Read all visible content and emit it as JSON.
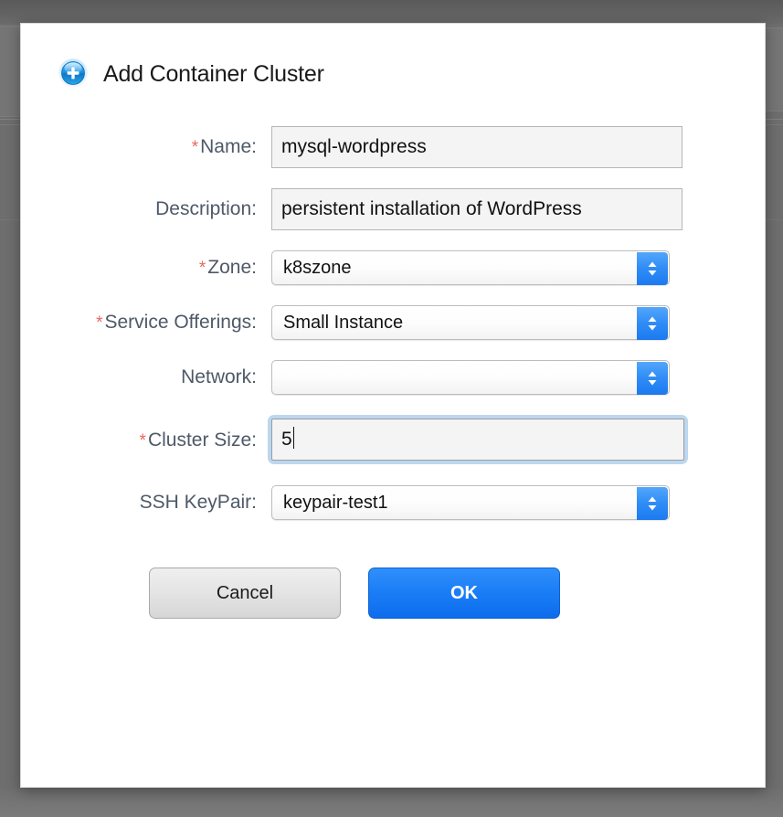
{
  "backdrop": {
    "color": "#6e6e6e"
  },
  "dialog": {
    "title": "Add Container Cluster",
    "title_icon": "add-plus-circle-icon",
    "accent_color": "#1a7df5",
    "required_marker": "*"
  },
  "form": {
    "fields": [
      {
        "key": "name",
        "label": "Name:",
        "required": true,
        "type": "text",
        "value": "mysql-wordpress",
        "placeholder": ""
      },
      {
        "key": "description",
        "label": "Description:",
        "required": false,
        "type": "text",
        "value": "persistent installation of WordPress",
        "placeholder": ""
      },
      {
        "key": "zone",
        "label": "Zone:",
        "required": true,
        "type": "select",
        "value": "k8szone"
      },
      {
        "key": "service_offerings",
        "label": "Service Offerings:",
        "required": true,
        "type": "select",
        "value": "Small Instance"
      },
      {
        "key": "network",
        "label": "Network:",
        "required": false,
        "type": "select",
        "value": ""
      },
      {
        "key": "cluster_size",
        "label": "Cluster Size:",
        "required": true,
        "type": "text",
        "value": "5",
        "focused": true
      },
      {
        "key": "ssh_keypair",
        "label": "SSH KeyPair:",
        "required": false,
        "type": "select",
        "value": "keypair-test1"
      }
    ]
  },
  "footer": {
    "cancel_label": "Cancel",
    "ok_label": "OK"
  }
}
